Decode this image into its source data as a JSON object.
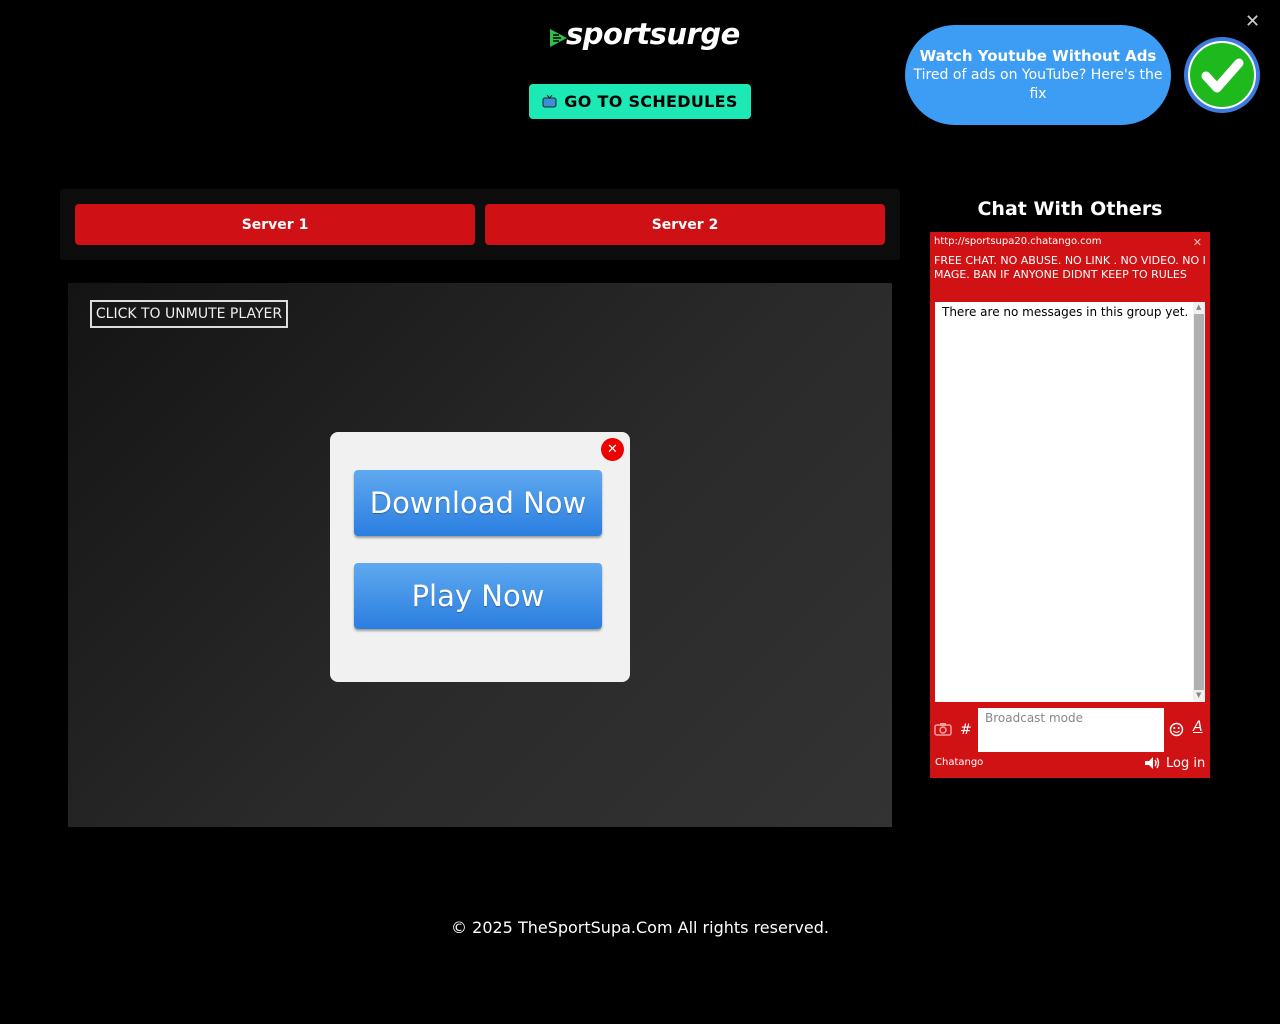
{
  "header": {
    "logo_text": "sportsurge",
    "schedules_label": "GO TO SCHEDULES"
  },
  "ad": {
    "title": "Watch Youtube Without Ads",
    "subtitle": "Tired of ads on YouTube? Here's the fix",
    "close_glyph": "✕",
    "accent_color": "#3d9df5"
  },
  "servers": [
    "Server 1",
    "Server 2"
  ],
  "player": {
    "unmute_label": "CLICK TO UNMUTE PLAYER"
  },
  "popup": {
    "close_glyph": "✕",
    "download_label": "Download Now",
    "play_label": "Play Now"
  },
  "chat": {
    "heading": "Chat With Others",
    "url": "http://sportsupa20.chatango.com",
    "close_glyph": "✕",
    "rules": "FREE CHAT. NO ABUSE. NO LINK . NO VIDEO. NO IMAGE. BAN IF ANYONE DIDNT KEEP TO RULES",
    "empty_message": "There are no messages in this group yet.",
    "input_placeholder": "Broadcast mode",
    "hash_glyph": "#",
    "font_glyph": "A",
    "brand": "Chatango",
    "login_label": "Log in",
    "accent_color": "#d11214"
  },
  "footer": {
    "copyright": "© 2025 TheSportSupa.Com All rights reserved."
  }
}
